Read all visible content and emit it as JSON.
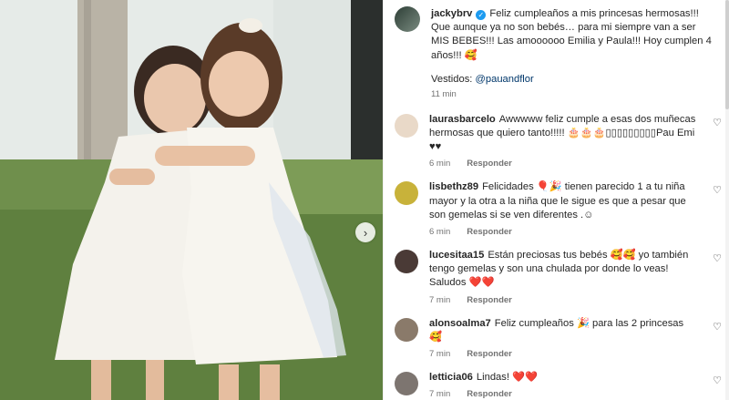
{
  "post": {
    "username": "jackybrv",
    "caption": "Feliz cumpleaños a mis princesas hermosas!!! Que aunque ya no son bebés… para mi siempre van a ser MIS BEBES!!! Las amoooooo Emilia y Paula!!! Hoy cumplen 4 años!!! 🥰",
    "vestidos_label": "Vestidos:",
    "vestidos_link": "@pauandflor",
    "time": "11 min"
  },
  "reply_label": "Responder",
  "comments": [
    {
      "username": "laurasbarcelo",
      "text": "Awwwww feliz cumple a esas dos muñecas hermosas que quiero tanto!!!!! 🎂🎂🎂▯▯▯▯▯▯▯▯▯Pau Emi ♥♥",
      "time": "6 min",
      "avatar_color": "#e9d9c8"
    },
    {
      "username": "lisbethz89",
      "text": "Felicidades 🎈🎉 tienen parecido 1 a tu niña mayor y la otra a la niña que le sigue es que a pesar que son gemelas si se ven diferentes .☺",
      "time": "6 min",
      "avatar_color": "#c8b23a"
    },
    {
      "username": "lucesitaa15",
      "text": "Están preciosas tus bebés 🥰🥰 yo también tengo gemelas y son una chulada por donde lo veas! Saludos ❤️❤️",
      "time": "7 min",
      "avatar_color": "#4a3a36"
    },
    {
      "username": "alonsoalma7",
      "text": "Feliz cumpleaños 🎉 para las 2 princesas 🥰",
      "time": "7 min",
      "avatar_color": "#8a7a6a"
    },
    {
      "username": "letticia06",
      "text": "Lindas! ❤️❤️",
      "time": "7 min",
      "avatar_color": "#7d7570"
    }
  ],
  "icons": {
    "heart": "♡",
    "next": "›",
    "verified": "✓"
  }
}
